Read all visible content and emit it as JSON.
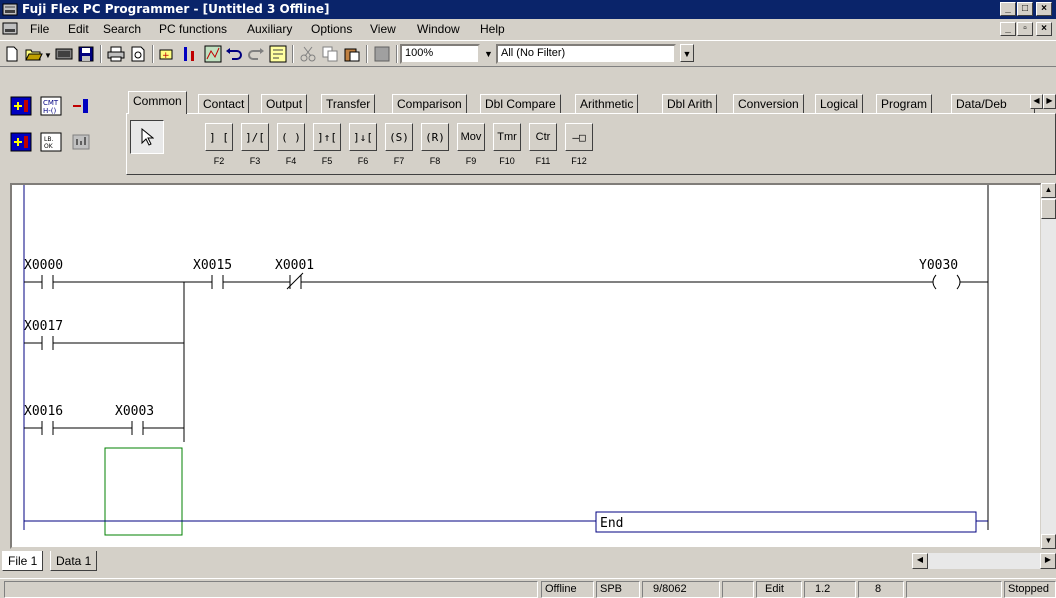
{
  "window": {
    "title": "Fuji Flex PC Programmer - [Untitled 3 Offline]",
    "app_controls": [
      "_",
      "□",
      "×"
    ],
    "mdi_controls": [
      "_",
      "▫",
      "×"
    ]
  },
  "menu": {
    "items": [
      "File",
      "Edit",
      "Search",
      "PC functions",
      "Auxiliary",
      "Options",
      "View",
      "Window",
      "Help"
    ]
  },
  "toolbar": {
    "zoom_value": "100%",
    "filter_value": "All (No Filter)",
    "icons": [
      "new-icon",
      "open-icon",
      "book-icon",
      "save-icon",
      "print-icon",
      "print-preview-icon",
      "ladder-insert-icon",
      "ladder-branch-icon",
      "monitor-icon",
      "undo-icon",
      "redo-icon",
      "compare-icon",
      "cut-icon",
      "copy-icon",
      "paste-icon",
      "help-icon"
    ]
  },
  "palette": {
    "tabs": [
      "Common",
      "Contact",
      "Output",
      "Transfer",
      "Comparison",
      "Dbl Compare",
      "Arithmetic",
      "Dbl Arith",
      "Conversion",
      "Logical",
      "Program",
      "Data/Deb"
    ],
    "active_tab": "Common",
    "instruction_buttons": [
      {
        "label": "] [",
        "key": "F2"
      },
      {
        "label": "]/[",
        "key": "F3"
      },
      {
        "label": "( )",
        "key": "F4"
      },
      {
        "label": "]↑[",
        "key": "F5"
      },
      {
        "label": "]↓[",
        "key": "F6"
      },
      {
        "label": "(S)",
        "key": "F7"
      },
      {
        "label": "(R)",
        "key": "F8"
      },
      {
        "label": "Mov",
        "key": "F9"
      },
      {
        "label": "Tmr",
        "key": "F10"
      },
      {
        "label": "Ctr",
        "key": "F11"
      },
      {
        "label": "—□",
        "key": "F12"
      }
    ],
    "left_icons": [
      "shift-icon",
      "cmt-icon",
      "shift-right-icon",
      "insert-row-icon",
      "address-icon",
      "block-icon",
      "pointer-icon"
    ],
    "cmt_label": "CMT",
    "lb_label": "LB."
  },
  "ladder": {
    "rung1": {
      "contacts": [
        "X0000",
        "X0015",
        "X0001"
      ],
      "coil": "Y0030"
    },
    "branch1": [
      "X0017"
    ],
    "branch2": [
      "X0016",
      "X0003"
    ],
    "end_label": "End"
  },
  "sheets": {
    "tabs": [
      "File 1",
      "Data 1"
    ],
    "active": "File 1"
  },
  "status": {
    "mode": "Offline",
    "type": "SPB",
    "steps": "9/8062",
    "edit": "Edit",
    "version": "1.2",
    "num": "8",
    "state": "Stopped"
  }
}
